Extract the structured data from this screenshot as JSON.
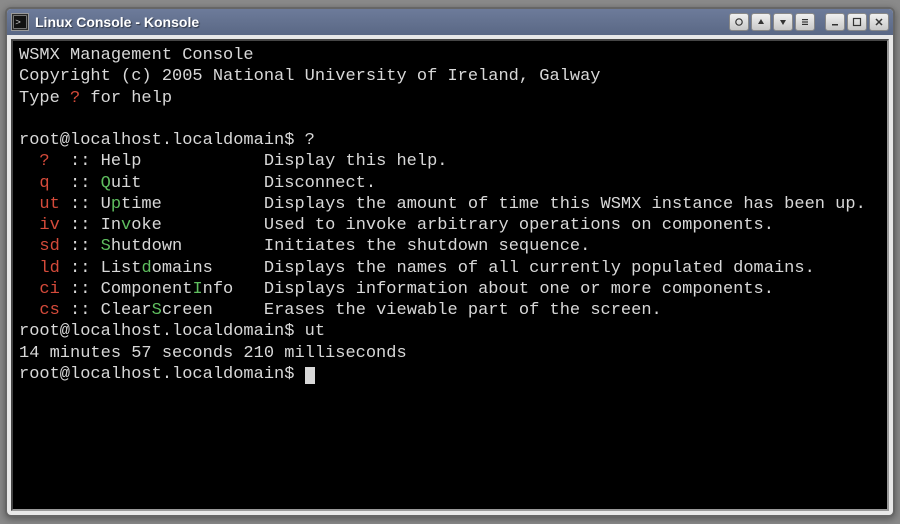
{
  "window": {
    "title": "Linux Console - Konsole"
  },
  "header": {
    "line1": "WSMX Management Console",
    "line2": "Copyright (c) 2005 National University of Ireland, Galway",
    "line3_pre": "Type ",
    "line3_cmd": "?",
    "line3_post": " for help"
  },
  "prompt1": {
    "text": "root@localhost.localdomain$ ",
    "cmd": "?"
  },
  "help": [
    {
      "alias": "?",
      "sep": "  :: ",
      "cmd_pre": "",
      "cmd_hl": "",
      "cmd_post": "Help",
      "pad": "            ",
      "desc": "Display this help."
    },
    {
      "alias": "q",
      "sep": "  :: ",
      "cmd_pre": "",
      "cmd_hl": "Q",
      "cmd_post": "uit",
      "pad": "            ",
      "desc": "Disconnect."
    },
    {
      "alias": "ut",
      "sep": " :: ",
      "cmd_pre": "U",
      "cmd_hl": "p",
      "cmd_post": "time",
      "pad": "          ",
      "desc": "Displays the amount of time this WSMX instance has been up."
    },
    {
      "alias": "iv",
      "sep": " :: ",
      "cmd_pre": "In",
      "cmd_hl": "v",
      "cmd_post": "oke",
      "pad": "          ",
      "desc": "Used to invoke arbitrary operations on components."
    },
    {
      "alias": "sd",
      "sep": " :: ",
      "cmd_pre": "",
      "cmd_hl": "S",
      "cmd_post": "hutdown",
      "pad": "        ",
      "desc": "Initiates the shutdown sequence."
    },
    {
      "alias": "ld",
      "sep": " :: ",
      "cmd_pre": "List",
      "cmd_hl": "d",
      "cmd_post": "omains",
      "pad": "     ",
      "desc": "Displays the names of all currently populated domains."
    },
    {
      "alias": "ci",
      "sep": " :: ",
      "cmd_pre": "Component",
      "cmd_hl": "I",
      "cmd_post": "nfo",
      "pad": "   ",
      "desc": "Displays information about one or more components."
    },
    {
      "alias": "cs",
      "sep": " :: ",
      "cmd_pre": "Clear",
      "cmd_hl": "S",
      "cmd_post": "creen",
      "pad": "     ",
      "desc": "Erases the viewable part of the screen."
    }
  ],
  "prompt2": {
    "text": "root@localhost.localdomain$ ",
    "cmd": "ut"
  },
  "output2": "14 minutes 57 seconds 210 milliseconds",
  "prompt3": {
    "text": "root@localhost.localdomain$ "
  }
}
